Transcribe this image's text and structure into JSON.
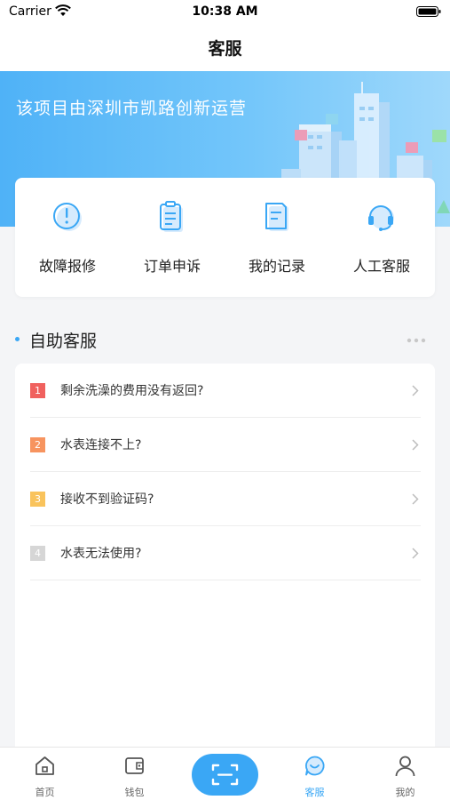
{
  "status_bar": {
    "carrier": "Carrier",
    "time": "10:38 AM"
  },
  "nav": {
    "title": "客服"
  },
  "banner": {
    "text": "该项目由深圳市凯路创新运营"
  },
  "quick_actions": [
    {
      "label": "故障报修",
      "icon": "alert-circle-icon"
    },
    {
      "label": "订单申诉",
      "icon": "clipboard-icon"
    },
    {
      "label": "我的记录",
      "icon": "document-icon"
    },
    {
      "label": "人工客服",
      "icon": "headset-icon"
    }
  ],
  "section": {
    "title": "自助客服"
  },
  "faq": [
    {
      "num": "1",
      "text": "剩余洗澡的费用没有返回?",
      "color": "#f0615e"
    },
    {
      "num": "2",
      "text": "水表连接不上?",
      "color": "#f7945f"
    },
    {
      "num": "3",
      "text": "接收不到验证码?",
      "color": "#f9c35c"
    },
    {
      "num": "4",
      "text": "水表无法使用?",
      "color": "#d6d6d6"
    }
  ],
  "tabs": [
    {
      "label": "首页",
      "icon": "home-icon"
    },
    {
      "label": "钱包",
      "icon": "wallet-icon"
    },
    {
      "label": "客服",
      "icon": "chat-icon",
      "active": true
    },
    {
      "label": "我的",
      "icon": "user-icon"
    }
  ],
  "colors": {
    "accent": "#3aa7f5",
    "banner_start": "#4fb2f7",
    "banner_end": "#9fd8fb"
  }
}
